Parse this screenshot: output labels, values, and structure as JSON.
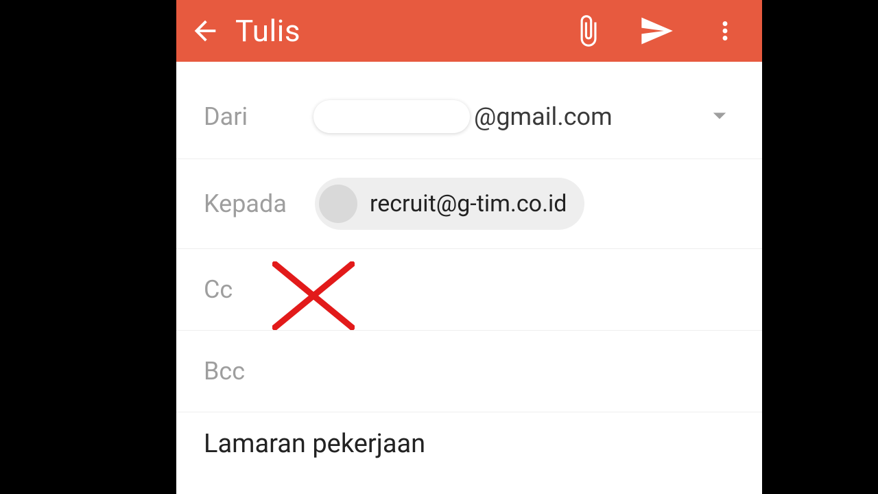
{
  "appbar": {
    "title": "Tulis"
  },
  "from": {
    "label": "Dari",
    "domain": "@gmail.com"
  },
  "to": {
    "label": "Kepada",
    "chip_email": "recruit@g-tim.co.id"
  },
  "cc": {
    "label": "Cc"
  },
  "bcc": {
    "label": "Bcc"
  },
  "subject": {
    "text": "Lamaran pekerjaan"
  }
}
